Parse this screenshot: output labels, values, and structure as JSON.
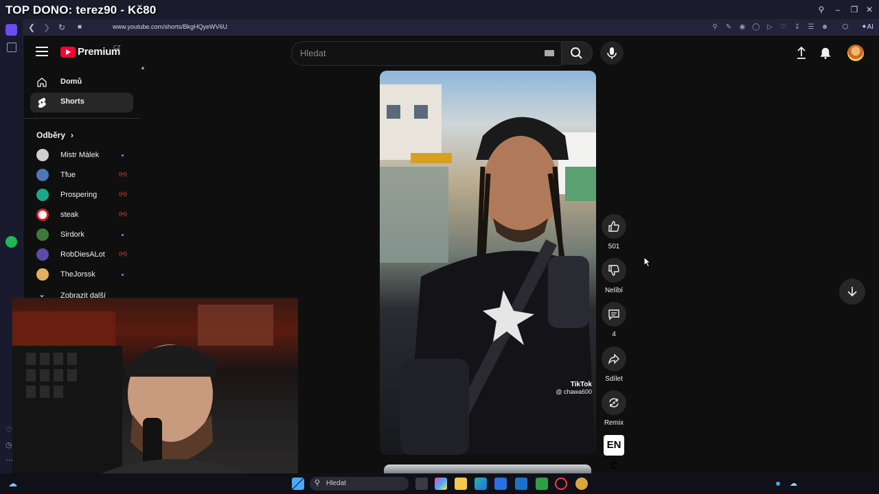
{
  "window": {
    "overlay_text": "TOP DONO: terez90 - Kč80",
    "url": "www.youtube.com/shorts/BkgHQyeWV6U"
  },
  "header": {
    "logo_text": "Premium",
    "logo_country": "CZ",
    "search_placeholder": "Hledat"
  },
  "sidebar": {
    "items": [
      {
        "label": "Domů",
        "icon": "home-icon"
      },
      {
        "label": "Shorts",
        "icon": "shorts-icon"
      }
    ],
    "subs_title": "Odběry",
    "subscriptions": [
      {
        "name": "Mistr Málek",
        "status": "dot",
        "color": "#cfcfcf"
      },
      {
        "name": "Tfue",
        "status": "live",
        "color": "#4a7ab6"
      },
      {
        "name": "Prospering",
        "status": "live",
        "color": "#1ca88a"
      },
      {
        "name": "steak",
        "status": "live",
        "color": "#ffffff"
      },
      {
        "name": "Sirdork",
        "status": "dot",
        "color": "#3d7a3a"
      },
      {
        "name": "RobDiesALot",
        "status": "live",
        "color": "#5b4aa8"
      },
      {
        "name": "TheJorssk",
        "status": "dot",
        "color": "#e0b060"
      }
    ],
    "show_more": "Zobrazit další"
  },
  "video": {
    "watermark_brand": "TikTok",
    "watermark_handle": "@ chawa600"
  },
  "actions": {
    "like_count": "501",
    "dislike_label": "Nelíbí",
    "comment_count": "4",
    "share_label": "Sdílet",
    "remix_label": "Remix",
    "thumb_text": "EN C"
  },
  "taskbar": {
    "search_placeholder": "Hledat"
  },
  "colors": {
    "accent": "#ff0033",
    "background": "#0f0f0f"
  }
}
